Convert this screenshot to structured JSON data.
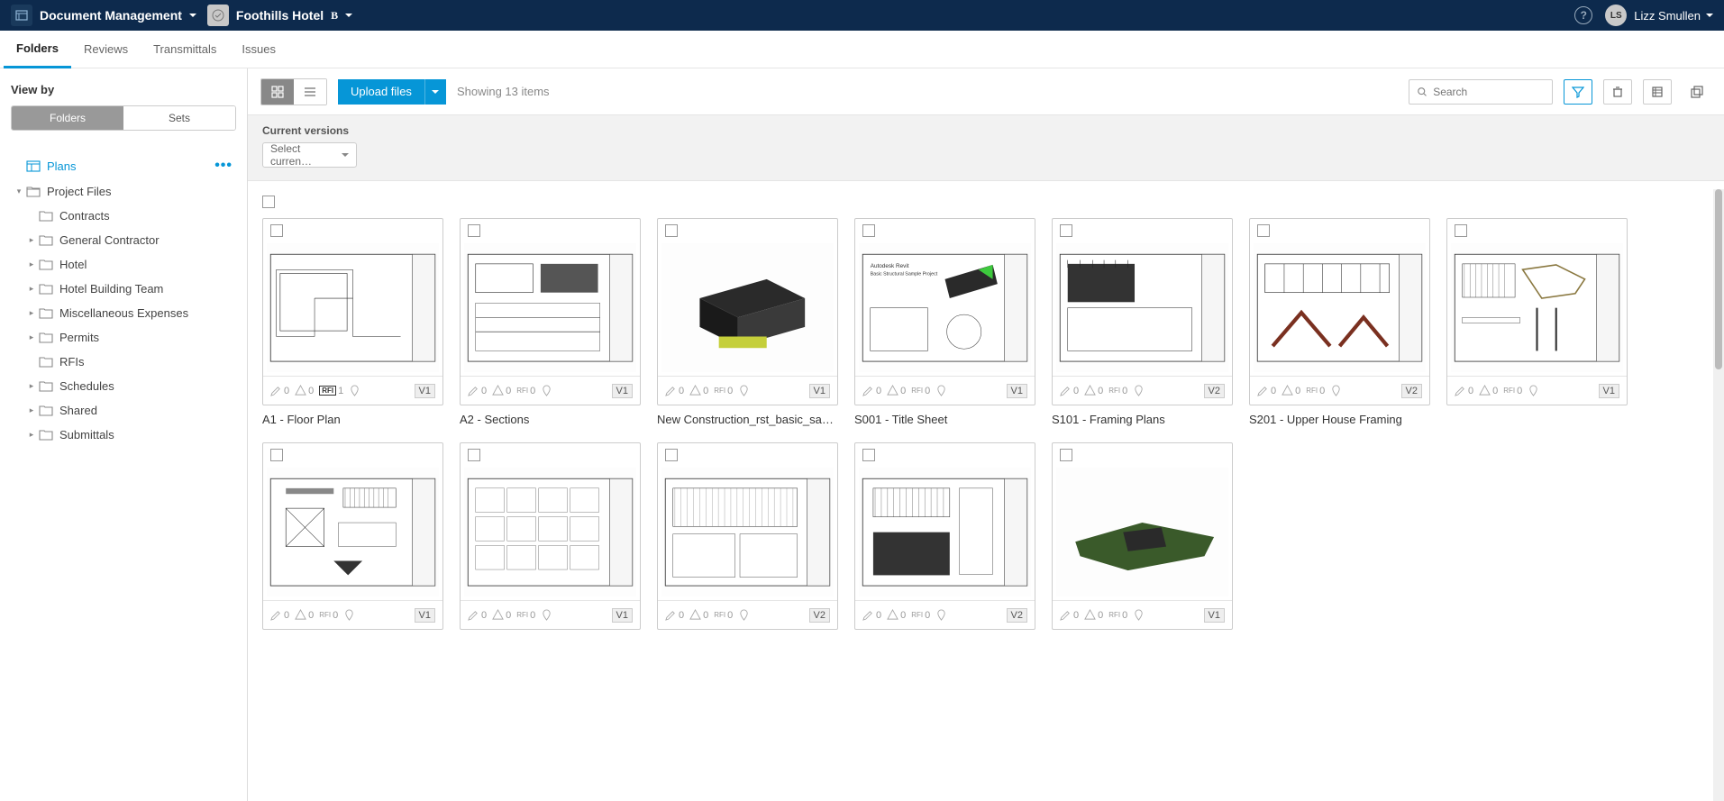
{
  "header": {
    "module": "Document Management",
    "project_name": "Foothills Hotel",
    "project_badge": "B",
    "user_initials": "LS",
    "user_name": "Lizz Smullen"
  },
  "tabs": [
    {
      "label": "Folders",
      "active": true
    },
    {
      "label": "Reviews",
      "active": false
    },
    {
      "label": "Transmittals",
      "active": false
    },
    {
      "label": "Issues",
      "active": false
    }
  ],
  "sidebar": {
    "viewby_label": "View by",
    "viewby_options": [
      {
        "label": "Folders",
        "active": true
      },
      {
        "label": "Sets",
        "active": false
      }
    ],
    "tree": [
      {
        "label": "Plans",
        "type": "plans",
        "active": true,
        "indent": 0,
        "caret": ""
      },
      {
        "label": "Project Files",
        "type": "folder-open",
        "active": false,
        "indent": 0,
        "caret": "▾"
      },
      {
        "label": "Contracts",
        "type": "folder",
        "active": false,
        "indent": 1,
        "caret": ""
      },
      {
        "label": "General Contractor",
        "type": "folder",
        "active": false,
        "indent": 1,
        "caret": "▸"
      },
      {
        "label": "Hotel",
        "type": "folder",
        "active": false,
        "indent": 1,
        "caret": "▸"
      },
      {
        "label": "Hotel Building Team",
        "type": "folder",
        "active": false,
        "indent": 1,
        "caret": "▸"
      },
      {
        "label": "Miscellaneous Expenses",
        "type": "folder",
        "active": false,
        "indent": 1,
        "caret": "▸"
      },
      {
        "label": "Permits",
        "type": "folder",
        "active": false,
        "indent": 1,
        "caret": "▸"
      },
      {
        "label": "RFIs",
        "type": "folder",
        "active": false,
        "indent": 1,
        "caret": ""
      },
      {
        "label": "Schedules",
        "type": "folder",
        "active": false,
        "indent": 1,
        "caret": "▸"
      },
      {
        "label": "Shared",
        "type": "folder",
        "active": false,
        "indent": 1,
        "caret": "▸"
      },
      {
        "label": "Submittals",
        "type": "folder",
        "active": false,
        "indent": 1,
        "caret": "▸"
      }
    ]
  },
  "toolbar": {
    "upload_label": "Upload files",
    "count_text": "Showing 13 items",
    "search_placeholder": "Search"
  },
  "filterbar": {
    "label": "Current versions",
    "select_text": "Select curren…"
  },
  "items": [
    {
      "title": "A1 - Floor Plan",
      "version": "V1",
      "markup": 0,
      "issue": 0,
      "rfi": 1,
      "rfi_highlight": true,
      "pin": true,
      "thumb": "plan"
    },
    {
      "title": "A2 - Sections",
      "version": "V1",
      "markup": 0,
      "issue": 0,
      "rfi": 0,
      "rfi_highlight": false,
      "pin": true,
      "thumb": "section"
    },
    {
      "title": "New Construction_rst_basic_samp…",
      "version": "V1",
      "markup": 0,
      "issue": 0,
      "rfi": 0,
      "rfi_highlight": false,
      "pin": true,
      "thumb": "3d"
    },
    {
      "title": "S001 - Title Sheet",
      "version": "V1",
      "markup": 0,
      "issue": 0,
      "rfi": 0,
      "rfi_highlight": false,
      "pin": true,
      "thumb": "title"
    },
    {
      "title": "S101 - Framing Plans",
      "version": "V2",
      "markup": 0,
      "issue": 0,
      "rfi": 0,
      "rfi_highlight": false,
      "pin": true,
      "thumb": "framing"
    },
    {
      "title": "S201 - Upper House Framing",
      "version": "V2",
      "markup": 0,
      "issue": 0,
      "rfi": 0,
      "rfi_highlight": false,
      "pin": true,
      "thumb": "roof"
    },
    {
      "title": "",
      "version": "V1",
      "markup": 0,
      "issue": 0,
      "rfi": 0,
      "rfi_highlight": false,
      "pin": true,
      "thumb": "struct1"
    },
    {
      "title": "",
      "version": "V1",
      "markup": 0,
      "issue": 0,
      "rfi": 0,
      "rfi_highlight": false,
      "pin": true,
      "thumb": "struct2"
    },
    {
      "title": "",
      "version": "V1",
      "markup": 0,
      "issue": 0,
      "rfi": 0,
      "rfi_highlight": false,
      "pin": true,
      "thumb": "sched"
    },
    {
      "title": "",
      "version": "V2",
      "markup": 0,
      "issue": 0,
      "rfi": 0,
      "rfi_highlight": false,
      "pin": true,
      "thumb": "grid"
    },
    {
      "title": "",
      "version": "V2",
      "markup": 0,
      "issue": 0,
      "rfi": 0,
      "rfi_highlight": false,
      "pin": true,
      "thumb": "elev"
    },
    {
      "title": "",
      "version": "V1",
      "markup": 0,
      "issue": 0,
      "rfi": 0,
      "rfi_highlight": false,
      "pin": true,
      "thumb": "site"
    }
  ]
}
